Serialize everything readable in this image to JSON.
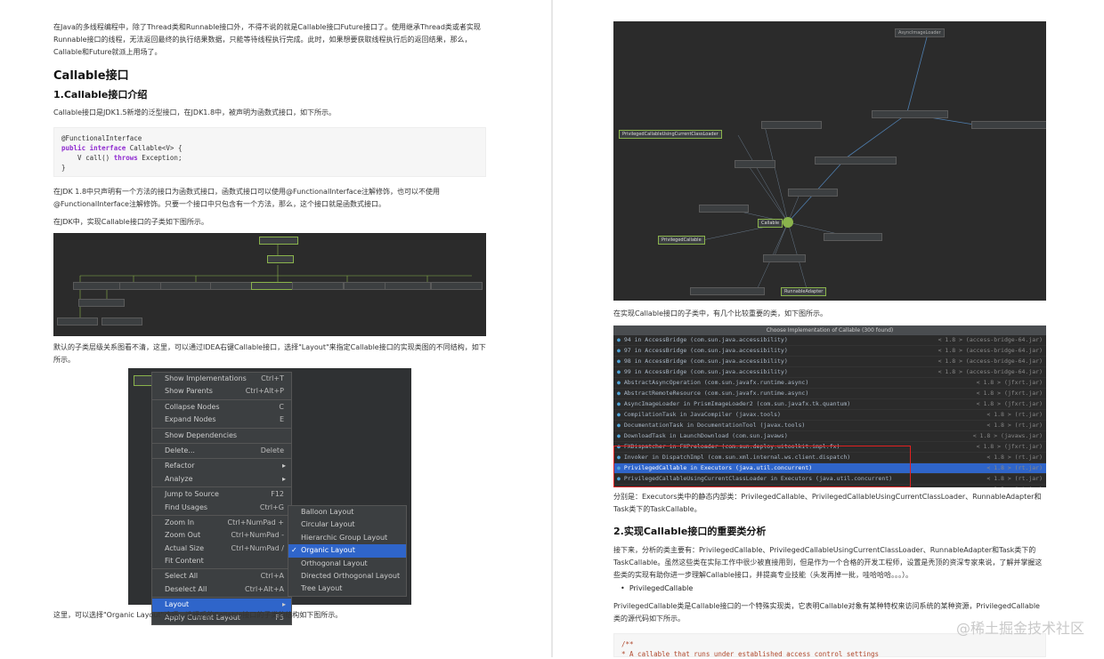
{
  "left": {
    "intro": "在Java的多线程编程中，除了Thread类和Runnable接口外，不得不说的就是Callable接口Future接口了。使用继承Thread类或者实现Runnable接口的线程，无法返回最终的执行结果数据，只能等待线程执行完成。此时，如果想要获取线程执行后的返回结果，那么，Callable和Future就派上用场了。",
    "h_callable": "Callable接口",
    "h_intro": "1.Callable接口介绍",
    "p_callable": "Callable接口是JDK1.5新增的泛型接口，在JDK1.8中，被声明为函数式接口，如下所示。",
    "code": {
      "line1": "@FunctionalInterface",
      "line2_kw": "public interface",
      "line2_rest": " Callable<V> {",
      "line3_a": "    V call() ",
      "line3_kw": "throws",
      "line3_b": " Exception;",
      "line4": "}"
    },
    "p_functional": "在JDK 1.8中只声明有一个方法的接口为函数式接口，函数式接口可以使用@FunctionalInterface注解修饰，也可以不使用@FunctionalInterface注解修饰。只要一个接口中只包含有一个方法，那么，这个接口就是函数式接口。",
    "p_subclass": "在JDK中，实现Callable接口的子类如下图所示。",
    "p_layout": "默认的子类层级关系图看不清，这里，可以通过IDEA右键Callable接口，选择\"Layout\"来指定Callable接口的实现类图的不同结构，如下所示。",
    "p_organic": "这里，可以选择\"Organic Layout\"选项，选择后的Callable接口的子类的结构如下图所示。",
    "menu": [
      {
        "label": "Show Implementations",
        "shortcut": "Ctrl+T"
      },
      {
        "label": "Show Parents",
        "shortcut": "Ctrl+Alt+P"
      },
      {
        "label": "Collapse Nodes",
        "shortcut": "C"
      },
      {
        "label": "Expand Nodes",
        "shortcut": "E"
      },
      {
        "label": "Show Dependencies",
        "shortcut": ""
      },
      {
        "label": "Delete...",
        "shortcut": "Delete"
      },
      {
        "label": "Refactor",
        "shortcut": ""
      },
      {
        "label": "Analyze",
        "shortcut": ""
      },
      {
        "label": "Jump to Source",
        "shortcut": "F12"
      },
      {
        "label": "Find Usages",
        "shortcut": "Ctrl+G"
      },
      {
        "label": "Zoom In",
        "shortcut": "Ctrl+NumPad +"
      },
      {
        "label": "Zoom Out",
        "shortcut": "Ctrl+NumPad -"
      },
      {
        "label": "Actual Size",
        "shortcut": "Ctrl+NumPad /"
      },
      {
        "label": "Fit Content",
        "shortcut": ""
      },
      {
        "label": "Select All",
        "shortcut": "Ctrl+A"
      },
      {
        "label": "Deselect All",
        "shortcut": "Ctrl+Alt+A"
      },
      {
        "label": "Layout",
        "shortcut": ""
      },
      {
        "label": "Apply Current Layout",
        "shortcut": "F5"
      }
    ],
    "submenu": [
      {
        "label": "Balloon Layout"
      },
      {
        "label": "Circular Layout"
      },
      {
        "label": "Hierarchic Group Layout"
      },
      {
        "label": "Organic Layout"
      },
      {
        "label": "Orthogonal Layout"
      },
      {
        "label": "Directed Orthogonal Layout"
      },
      {
        "label": "Tree Layout"
      }
    ]
  },
  "right": {
    "diagram": {
      "center": "Callable",
      "n_async": "AsyncImageLoader",
      "n_using": "PrivilegedCallableUsingCurrentClassLoader",
      "n_priv": "PrivilegedCallable",
      "n_runnable": "RunnableAdapter"
    },
    "p_important": "在实现Callable接口的子类中，有几个比较重要的类，如下图所示。",
    "list_title": "Choose Implementation of Callable (300 found)",
    "list": [
      {
        "name": "94 in AccessBridge (com.sun.java.accessibility)",
        "loc": "< 1.8 > (access-bridge-64.jar)"
      },
      {
        "name": "97 in AccessBridge (com.sun.java.accessibility)",
        "loc": "< 1.8 > (access-bridge-64.jar)"
      },
      {
        "name": "98 in AccessBridge (com.sun.java.accessibility)",
        "loc": "< 1.8 > (access-bridge-64.jar)"
      },
      {
        "name": "99 in AccessBridge (com.sun.java.accessibility)",
        "loc": "< 1.8 > (access-bridge-64.jar)"
      },
      {
        "name": "AbstractAsyncOperation (com.sun.javafx.runtime.async)",
        "loc": "< 1.8 > (jfxrt.jar)"
      },
      {
        "name": "AbstractRemoteResource (com.sun.javafx.runtime.async)",
        "loc": "< 1.8 > (jfxrt.jar)"
      },
      {
        "name": "AsyncImageLoader in PrismImageLoader2 (com.sun.javafx.tk.quantum)",
        "loc": "< 1.8 > (jfxrt.jar)"
      },
      {
        "name": "CompilationTask in JavaCompiler (javax.tools)",
        "loc": "< 1.8 > (rt.jar)"
      },
      {
        "name": "DocumentationTask in DocumentationTool (javax.tools)",
        "loc": "< 1.8 > (rt.jar)"
      },
      {
        "name": "DownloadTask in LaunchDownload (com.sun.javaws)",
        "loc": "< 1.8 > (javaws.jar)"
      },
      {
        "name": "FXDispatcher in FXPreloader (com.sun.deploy.uitoolkit.impl.fx)",
        "loc": "< 1.8 > (jfxrt.jar)"
      },
      {
        "name": "Invoker in DispatchImpl (com.sun.xml.internal.ws.client.dispatch)",
        "loc": "< 1.8 > (rt.jar)"
      },
      {
        "name": "PrivilegedCallable in Executors (java.util.concurrent)",
        "loc": "< 1.8 > (rt.jar)"
      },
      {
        "name": "PrivilegedCallableUsingCurrentClassLoader in Executors (java.util.concurrent)",
        "loc": "< 1.8 > (rt.jar)"
      },
      {
        "name": "RunnableAdapter in Executors (java.util.concurrent)",
        "loc": "< 1.8 > (rt.jar)"
      },
      {
        "name": "TaskCallable in Task (javafx.concurrent)",
        "loc": "< 1.8 > (jfxrt.jar)"
      }
    ],
    "p_executors": "分别是：Executors类中的静态内部类：PrivilegedCallable、PrivilegedCallableUsingCurrentClassLoader、RunnableAdapter和Task类下的TaskCallable。",
    "h_analysis": "2.实现Callable接口的重要类分析",
    "p_analysis": "接下来，分析的类主要有：PrivilegedCallable、PrivilegedCallableUsingCurrentClassLoader、RunnableAdapter和Task类下的TaskCallable。虽然这些类在实际工作中很少被直接用到，但是作为一个合格的开发工程师，设置是秃顶的资深专家来说，了解并掌握这些类的实现有助你进一步理解Callable接口，并提高专业技能（头发再掉一批，哇哈哈哈。。。）。",
    "bullet": "PrivilegedCallable",
    "p_privileged": "PrivilegedCallable类是Callable接口的一个特殊实现类，它表明Callable对象有某种特权来访问系统的某种资源，PrivilegedCallable类的源代码如下所示。",
    "code2_a": "/**",
    "code2_b": " * A callable that runs under established access control settings"
  },
  "watermark": "@稀土掘金技术社区"
}
